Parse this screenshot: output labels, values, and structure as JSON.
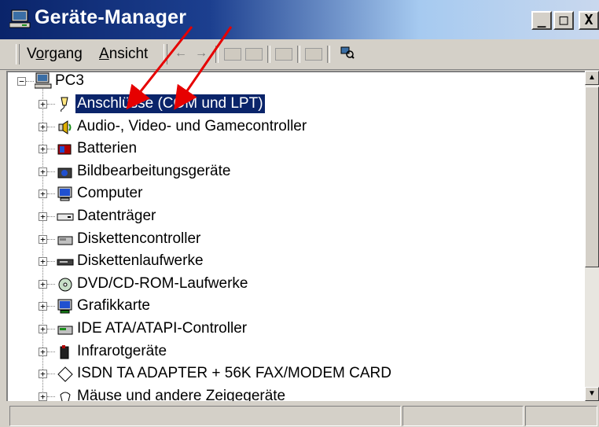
{
  "window": {
    "title": "Geräte-Manager",
    "icon": "computer-icon",
    "controls": {
      "minimize": "_",
      "maximize": "□",
      "close": "X"
    }
  },
  "menu": {
    "action": "Vorgang",
    "action_mnemonic": "o",
    "view": "Ansicht",
    "view_mnemonic": "A"
  },
  "toolbar": {
    "icons": [
      "back-arrow-icon",
      "forward-arrow-icon",
      "tree-view-icon",
      "details-view-icon",
      "properties-icon",
      "help-icon",
      "scan-hardware-icon"
    ]
  },
  "tree": {
    "root": {
      "label": "PC3",
      "icon": "computer-icon",
      "expanded": true
    },
    "items": [
      {
        "label": "Anschlüsse (COM und LPT)",
        "icon": "port-icon",
        "selected": true
      },
      {
        "label": "Audio-, Video- und Gamecontroller",
        "icon": "speaker-icon"
      },
      {
        "label": "Batterien",
        "icon": "battery-icon"
      },
      {
        "label": "Bildbearbeitungsgeräte",
        "icon": "camera-icon"
      },
      {
        "label": "Computer",
        "icon": "monitor-icon"
      },
      {
        "label": "Datenträger",
        "icon": "disk-drive-icon"
      },
      {
        "label": "Diskettencontroller",
        "icon": "floppy-controller-icon"
      },
      {
        "label": "Diskettenlaufwerke",
        "icon": "floppy-drive-icon"
      },
      {
        "label": "DVD/CD-ROM-Laufwerke",
        "icon": "cdrom-icon"
      },
      {
        "label": "Grafikkarte",
        "icon": "display-adapter-icon"
      },
      {
        "label": "IDE ATA/ATAPI-Controller",
        "icon": "ide-controller-icon"
      },
      {
        "label": "Infrarotgeräte",
        "icon": "infrared-icon"
      },
      {
        "label": "ISDN TA ADAPTER + 56K FAX/MODEM CARD",
        "icon": "isdn-adapter-icon"
      },
      {
        "label": "Mäuse und andere Zeigegeräte",
        "icon": "mouse-icon"
      }
    ]
  },
  "colors": {
    "selection": "#0a246a",
    "annotation_arrow": "#e60000",
    "titlebar_start": "#0a246a"
  }
}
